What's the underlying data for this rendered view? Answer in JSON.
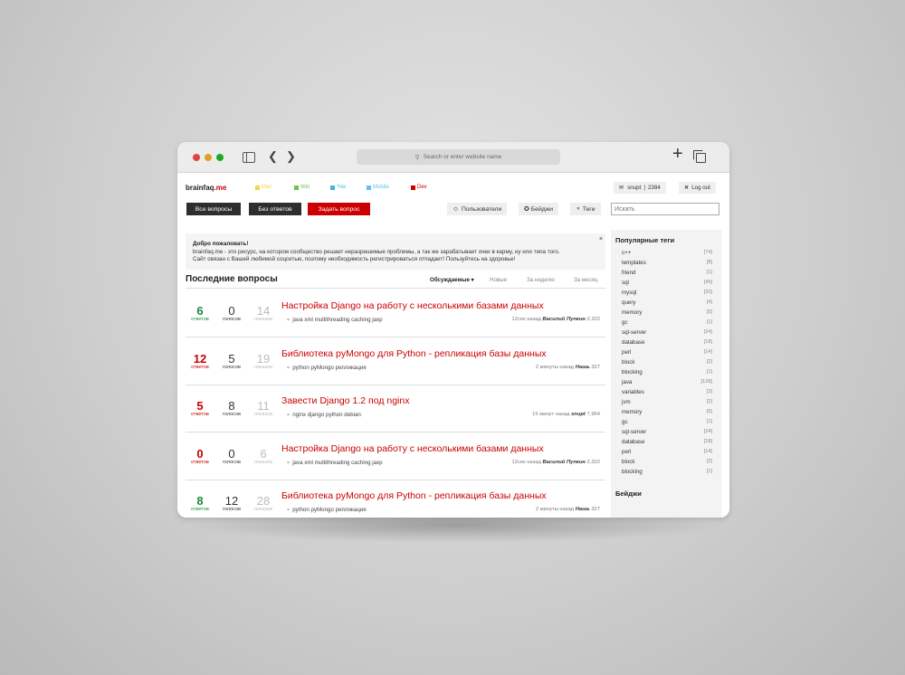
{
  "browser": {
    "url_placeholder": "Search or enter website name"
  },
  "site": {
    "logo_main": "brainfaq",
    "logo_tld": ".me",
    "categories": [
      {
        "label": "Mac",
        "color": "#f2d64b"
      },
      {
        "label": "Win",
        "color": "#6cc24a"
      },
      {
        "label": "*nix",
        "color": "#46b4d8"
      },
      {
        "label": "Mobile",
        "color": "#5cc6e6"
      },
      {
        "label": "Dev",
        "color": "#cc0000"
      }
    ],
    "user": "snupt",
    "user_score": "2384",
    "logout": "Log out"
  },
  "toolbar": {
    "all_questions": "Все вопросы",
    "unanswered": "Без ответов",
    "ask": "Задать вопрос",
    "users": "Пользователи",
    "badges": "Бейджи",
    "tags": "Теги",
    "search_placeholder": "Искать"
  },
  "welcome": {
    "title": "Добро пожаловать!",
    "line1": "brainfaq.me - это ресурс, на котором сообщество решает неразрешимые проблемы, а так же зарабатывает очки в карму, ну или типа того.",
    "line2": "Сайт связан с Вашей любимой соцсетью, поэтому необходимость регистрироваться отпадает! Пользуйтесь на здоровье!",
    "close": "×"
  },
  "questions_section": {
    "title": "Последние вопросы",
    "sorts": [
      "Обсуждаемые ▾",
      "Новые",
      "За неделю",
      "За месяц"
    ]
  },
  "questions": [
    {
      "answers": "6",
      "answers_label": "ответов",
      "votes": "0",
      "votes_label": "голосов",
      "views": "14",
      "views_label": "показов",
      "answers_color": "#1a8a3a",
      "title": "Настройка Django на работу с несколькими базами данных",
      "tags": "java xml multithreading caching jaxp",
      "time": "12сек назад",
      "author": "Василий Пупкин",
      "rep": "2,322"
    },
    {
      "answers": "12",
      "answers_label": "ответов",
      "votes": "5",
      "votes_label": "голосов",
      "views": "19",
      "views_label": "показов",
      "answers_color": "#cc0000",
      "title": "Библиотека pyMongo для Python - репликация базы данных",
      "tags": "python pyMongo репликация",
      "time": "2 минуты назад",
      "author": "Нашь",
      "rep": "327"
    },
    {
      "answers": "5",
      "answers_label": "ответов",
      "votes": "8",
      "votes_label": "голосов",
      "views": "11",
      "views_label": "показов",
      "answers_color": "#cc0000",
      "title": "Завести Django 1.2 под nginx",
      "tags": "nginx django python debian",
      "time": "15 минут назад",
      "author": "snupt",
      "rep": "7,964"
    },
    {
      "answers": "0",
      "answers_label": "ответов",
      "votes": "0",
      "votes_label": "голосов",
      "views": "6",
      "views_label": "показов",
      "answers_color": "#cc0000",
      "title": "Настройка Django на работу с несколькими базами данных",
      "tags": "java xml multithreading caching jaxp",
      "time": "12сек назад",
      "author": "Василий Пупкин",
      "rep": "2,322"
    },
    {
      "answers": "8",
      "answers_label": "ответов",
      "votes": "12",
      "votes_label": "голосов",
      "views": "28",
      "views_label": "показов",
      "answers_color": "#1a8a3a",
      "title": "Библиотека pyMongo для Python - репликация базы данных",
      "tags": "python pyMongo репликация",
      "time": "2 минуты назад",
      "author": "Нашь",
      "rep": "327"
    }
  ],
  "popular_tags": {
    "title": "Популярные теги",
    "items": [
      {
        "name": "c++",
        "count": "[74]"
      },
      {
        "name": "templates",
        "count": "[8]"
      },
      {
        "name": "friend",
        "count": "[1]"
      },
      {
        "name": "sql",
        "count": "[45]"
      },
      {
        "name": "mysql",
        "count": "[32]"
      },
      {
        "name": "query",
        "count": "[4]"
      },
      {
        "name": "memory",
        "count": "[5]"
      },
      {
        "name": "gc",
        "count": "[1]"
      },
      {
        "name": "sql-server",
        "count": "[24]"
      },
      {
        "name": "database",
        "count": "[18]"
      },
      {
        "name": "perl",
        "count": "[14]"
      },
      {
        "name": "block",
        "count": "[2]"
      },
      {
        "name": "blocking",
        "count": "[1]"
      },
      {
        "name": "java",
        "count": "[128]"
      },
      {
        "name": "variables",
        "count": "[3]"
      },
      {
        "name": "jvm",
        "count": "[2]"
      },
      {
        "name": "memory",
        "count": "[5]"
      },
      {
        "name": "gc",
        "count": "[1]"
      },
      {
        "name": "sql-server",
        "count": "[24]"
      },
      {
        "name": "database",
        "count": "[18]"
      },
      {
        "name": "perl",
        "count": "[14]"
      },
      {
        "name": "block",
        "count": "[2]"
      },
      {
        "name": "blocking",
        "count": "[1]"
      }
    ]
  },
  "badges_panel": {
    "title": "Бейджи"
  }
}
